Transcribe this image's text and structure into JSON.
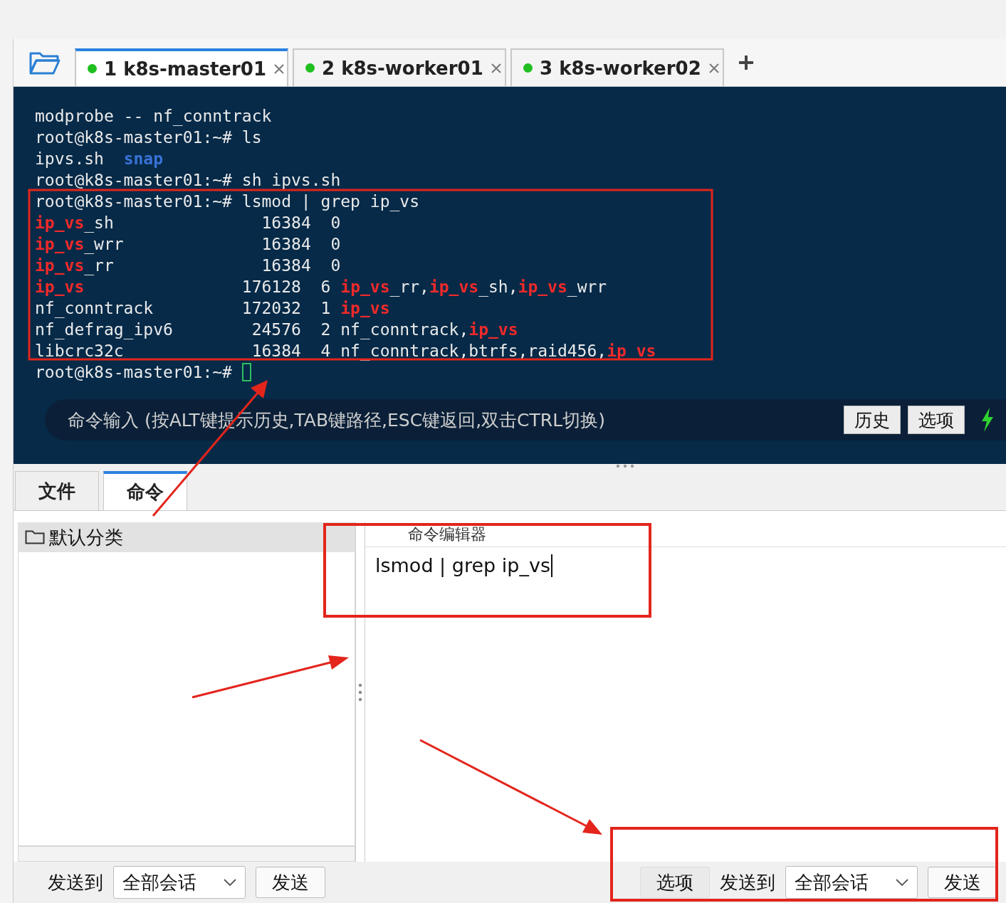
{
  "session_tabs": [
    {
      "label": "1 k8s-master01",
      "selected": true,
      "color": "#1fbf1f"
    },
    {
      "label": "2 k8s-worker01",
      "selected": false,
      "color": "#1fbf1f"
    },
    {
      "label": "3 k8s-worker02",
      "selected": false,
      "color": "#1fbf1f"
    }
  ],
  "terminal": {
    "lines": [
      [
        {
          "text": "modprobe -- nf_conntrack",
          "kind": "plain"
        }
      ],
      [
        {
          "text": "root@k8s-master01:~# ls",
          "kind": "plain"
        }
      ],
      [
        {
          "text": "ipvs.sh  ",
          "kind": "plain"
        },
        {
          "text": "snap",
          "kind": "dir"
        }
      ],
      [
        {
          "text": "root@k8s-master01:~# sh ipvs.sh",
          "kind": "plain"
        }
      ],
      [
        {
          "text": "root@k8s-master01:~# lsmod | grep ip_vs",
          "kind": "plain"
        }
      ],
      [
        {
          "text": "ip_vs",
          "kind": "match"
        },
        {
          "text": "_sh               16384  0",
          "kind": "plain"
        }
      ],
      [
        {
          "text": "ip_vs",
          "kind": "match"
        },
        {
          "text": "_wrr              16384  0",
          "kind": "plain"
        }
      ],
      [
        {
          "text": "ip_vs",
          "kind": "match"
        },
        {
          "text": "_rr               16384  0",
          "kind": "plain"
        }
      ],
      [
        {
          "text": "ip_vs",
          "kind": "match"
        },
        {
          "text": "                176128  6 ",
          "kind": "plain"
        },
        {
          "text": "ip_vs",
          "kind": "match"
        },
        {
          "text": "_rr,",
          "kind": "plain"
        },
        {
          "text": "ip_vs",
          "kind": "match"
        },
        {
          "text": "_sh,",
          "kind": "plain"
        },
        {
          "text": "ip_vs",
          "kind": "match"
        },
        {
          "text": "_wrr",
          "kind": "plain"
        }
      ],
      [
        {
          "text": "nf_conntrack         172032  1 ",
          "kind": "plain"
        },
        {
          "text": "ip_vs",
          "kind": "match"
        }
      ],
      [
        {
          "text": "nf_defrag_ipv6        24576  2 nf_conntrack,",
          "kind": "plain"
        },
        {
          "text": "ip_vs",
          "kind": "match"
        }
      ],
      [
        {
          "text": "libcrc32c             16384  4 nf_conntrack,btrfs,raid456,",
          "kind": "plain"
        },
        {
          "text": "ip_vs",
          "kind": "match"
        }
      ],
      [
        {
          "text": "root@k8s-master01:~# ",
          "kind": "plain"
        }
      ]
    ],
    "command_input": {
      "placeholder": "命令输入 (按ALT键提示历史,TAB键路径,ESC键返回,双击CTRL切换)"
    },
    "buttons": [
      "历史",
      "选项"
    ]
  },
  "panel_tabs": [
    {
      "label": "文件",
      "selected": false
    },
    {
      "label": "命令",
      "selected": true
    }
  ],
  "category": {
    "label": "默认分类"
  },
  "editor": {
    "title": "命令编辑器",
    "value": "lsmod | grep ip_vs"
  },
  "left_footer": {
    "send_to_label": "发送到",
    "target": "全部会话",
    "send_button": "发送"
  },
  "right_footer": {
    "options_button": "选项",
    "send_to_label": "发送到",
    "target": "全部会话",
    "send_button": "发送"
  }
}
